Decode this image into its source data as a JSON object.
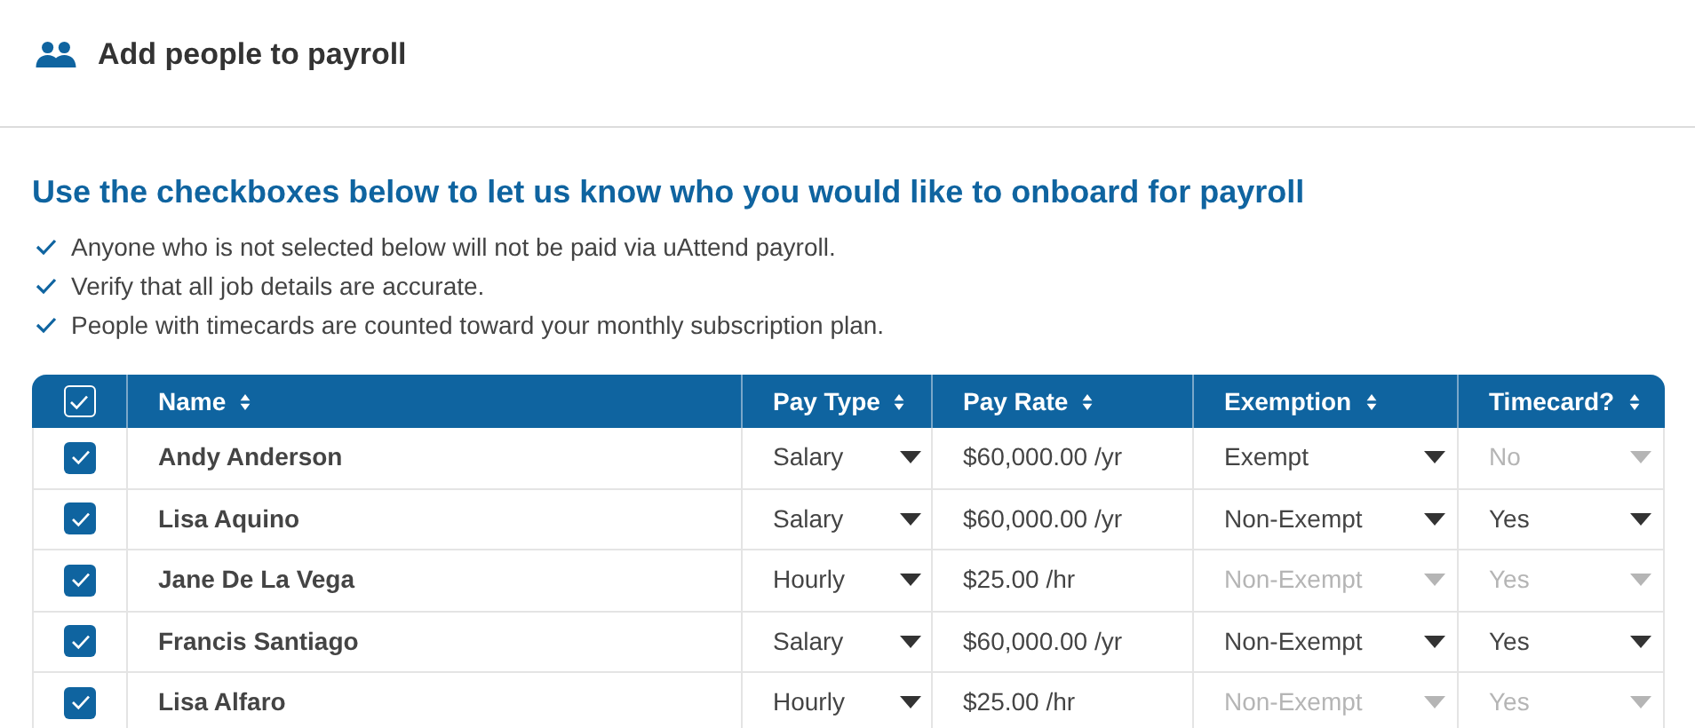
{
  "header": {
    "title": "Add people to payroll"
  },
  "instructions": {
    "heading": "Use the checkboxes below to let us know who you would like to onboard for payroll",
    "items": [
      "Anyone who is not selected below will not be paid via uAttend payroll.",
      "Verify that all job details are accurate.",
      "People with timecards are counted toward your monthly subscription plan."
    ]
  },
  "table": {
    "select_all": {
      "checked": true
    },
    "columns": [
      "Name",
      "Pay Type",
      "Pay Rate",
      "Exemption",
      "Timecard?"
    ],
    "rows": [
      {
        "checked": true,
        "name": "Andy Anderson",
        "pay_type": {
          "value": "Salary",
          "disabled": false
        },
        "pay_rate": "$60,000.00 /yr",
        "exemption": {
          "value": "Exempt",
          "disabled": false
        },
        "timecard": {
          "value": "No",
          "disabled": true
        }
      },
      {
        "checked": true,
        "name": "Lisa Aquino",
        "pay_type": {
          "value": "Salary",
          "disabled": false
        },
        "pay_rate": "$60,000.00 /yr",
        "exemption": {
          "value": "Non-Exempt",
          "disabled": false
        },
        "timecard": {
          "value": "Yes",
          "disabled": false
        }
      },
      {
        "checked": true,
        "name": "Jane De La Vega",
        "pay_type": {
          "value": "Hourly",
          "disabled": false
        },
        "pay_rate": "$25.00 /hr",
        "exemption": {
          "value": "Non-Exempt",
          "disabled": true
        },
        "timecard": {
          "value": "Yes",
          "disabled": true
        }
      },
      {
        "checked": true,
        "name": "Francis Santiago",
        "pay_type": {
          "value": "Salary",
          "disabled": false
        },
        "pay_rate": "$60,000.00 /yr",
        "exemption": {
          "value": "Non-Exempt",
          "disabled": false
        },
        "timecard": {
          "value": "Yes",
          "disabled": false
        }
      },
      {
        "checked": true,
        "name": "Lisa Alfaro",
        "pay_type": {
          "value": "Hourly",
          "disabled": false
        },
        "pay_rate": "$25.00 /hr",
        "exemption": {
          "value": "Non-Exempt",
          "disabled": true
        },
        "timecard": {
          "value": "Yes",
          "disabled": true
        }
      }
    ]
  }
}
